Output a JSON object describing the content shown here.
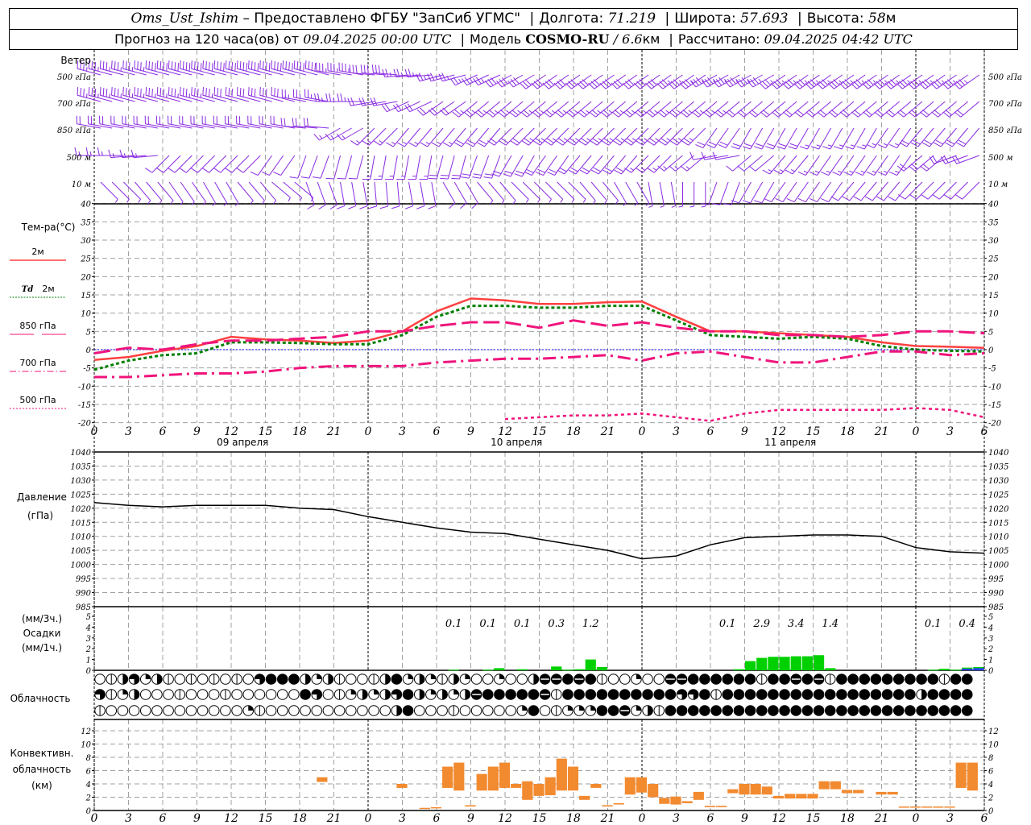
{
  "header": {
    "station": "Oms_Ust_Ishim",
    "provided": "– Предоставлено ФГБУ \"ЗапСиб УГМС\"",
    "lon_label": "Долгота:",
    "lon": "71.219",
    "lat_label": "Широта:",
    "lat": "57.693",
    "alt_label": "Высота:",
    "alt": "58",
    "alt_unit": "м",
    "forecast_label": "Прогноз на 120 часа(ов) от",
    "forecast_start": "09.04.2025 00:00 UTC",
    "model_label": "Модель",
    "model": "COSMO-RU",
    "model_res": "/ 6.6",
    "model_res_unit": "км",
    "computed_label": "Рассчитано:",
    "computed": "09.04.2025 04:42 UTC"
  },
  "labels": {
    "wind": "Ветер",
    "levels": [
      "500 гПа",
      "700 гПа",
      "850 гПа",
      "500 м",
      "10 м"
    ],
    "temp": "Тем-ра(°С)",
    "t2m": "2м",
    "td": "Td",
    "td2m": "2м",
    "t850": "850 гПа",
    "t700": "700 гПа",
    "t500": "500 гПа",
    "pressure": "Давление",
    "pressure_unit": "(гПа)",
    "precip_3h": "(мм/3ч.)",
    "precip": "Осадки",
    "precip_1h": "(мм/1ч.)",
    "cloud": "Облачность",
    "conv1": "Конвективн.",
    "conv2": "облачность",
    "conv3": "(км)"
  },
  "colors": {
    "wind": "#8a2be2",
    "t2m": "#ff4040",
    "td2m": "#008000",
    "levels": "#f0147c",
    "zero": "#0000ff",
    "pressure": "#000000",
    "rain": "#00d000",
    "snow": "#2040ff",
    "conv": "#f28a30",
    "grid": "#a0a0a0"
  },
  "chart_data": [
    {
      "type": "barbs",
      "name_label": "Ветер",
      "x_hours": [
        0,
        3,
        6,
        9,
        12,
        15,
        18,
        21,
        24,
        27,
        30,
        33,
        36,
        39,
        42,
        45,
        48,
        51,
        54,
        57,
        60,
        63,
        66,
        69,
        72,
        75,
        78
      ],
      "series": [
        {
          "name": "500 гПа",
          "dir": [
            285,
            285,
            285,
            285,
            285,
            285,
            285,
            280,
            275,
            265,
            255,
            245,
            240,
            235,
            235,
            235,
            235,
            235,
            240,
            240,
            235,
            235,
            235,
            235,
            235,
            235,
            235
          ],
          "speed": [
            35,
            35,
            40,
            40,
            40,
            40,
            40,
            35,
            30,
            25,
            25,
            25,
            30,
            30,
            30,
            30,
            30,
            35,
            35,
            35,
            35,
            35,
            35,
            35,
            35,
            35,
            35
          ]
        },
        {
          "name": "700 гПа",
          "dir": [
            285,
            285,
            285,
            285,
            285,
            285,
            280,
            270,
            260,
            245,
            235,
            230,
            230,
            230,
            230,
            230,
            230,
            230,
            230,
            230,
            230,
            230,
            230,
            230,
            230,
            230,
            230
          ],
          "speed": [
            35,
            35,
            35,
            35,
            30,
            30,
            25,
            25,
            20,
            20,
            20,
            25,
            25,
            25,
            25,
            25,
            25,
            25,
            25,
            20,
            20,
            20,
            20,
            20,
            20,
            20,
            20
          ]
        },
        {
          "name": "850 гПа",
          "dir": [
            280,
            280,
            280,
            280,
            280,
            280,
            275,
            240,
            225,
            220,
            220,
            220,
            225,
            225,
            225,
            225,
            225,
            225,
            215,
            210,
            210,
            210,
            210,
            215,
            220,
            220,
            220
          ],
          "speed": [
            20,
            20,
            20,
            20,
            20,
            20,
            20,
            15,
            15,
            15,
            15,
            20,
            20,
            25,
            25,
            25,
            25,
            25,
            20,
            20,
            20,
            15,
            15,
            15,
            20,
            20,
            20
          ]
        },
        {
          "name": "500 м",
          "dir": [
            270,
            265,
            225,
            225,
            225,
            215,
            200,
            195,
            190,
            190,
            195,
            200,
            210,
            215,
            220,
            220,
            225,
            230,
            260,
            230,
            220,
            215,
            215,
            215,
            230,
            250,
            240
          ],
          "speed": [
            15,
            15,
            10,
            10,
            10,
            10,
            10,
            10,
            15,
            15,
            20,
            20,
            20,
            20,
            20,
            20,
            15,
            15,
            10,
            10,
            15,
            15,
            15,
            15,
            20,
            20,
            15
          ]
        },
        {
          "name": "10 м",
          "dir": [
            135,
            140,
            145,
            150,
            140,
            130,
            160,
            170,
            175,
            170,
            150,
            140,
            135,
            135,
            140,
            150,
            170,
            180,
            200,
            210,
            215,
            215,
            220,
            220,
            225,
            225,
            225
          ],
          "speed": [
            5,
            5,
            5,
            5,
            5,
            5,
            10,
            10,
            10,
            10,
            10,
            5,
            5,
            5,
            5,
            5,
            5,
            5,
            10,
            10,
            10,
            10,
            10,
            10,
            10,
            10,
            10
          ]
        }
      ]
    },
    {
      "type": "line",
      "ylabel": "Тем-ра(°С)",
      "ylim": [
        -20,
        40
      ],
      "yticks": [
        40,
        35,
        30,
        25,
        20,
        15,
        10,
        5,
        0,
        -5,
        -10,
        -15,
        -20
      ],
      "grid": true,
      "x_hours": [
        0,
        3,
        6,
        9,
        12,
        15,
        18,
        21,
        24,
        27,
        30,
        33,
        36,
        39,
        42,
        45,
        48,
        51,
        54,
        57,
        60,
        63,
        66,
        69,
        72,
        75,
        78
      ],
      "x_tick_labels": [
        "0",
        "3",
        "6",
        "9",
        "12",
        "15",
        "18",
        "21",
        "0",
        "3",
        "6",
        "9",
        "12",
        "15",
        "18",
        "21",
        "0",
        "3",
        "6",
        "9",
        "12",
        "15",
        "18",
        "21",
        "0",
        "3",
        "6"
      ],
      "date_labels": [
        {
          "hour": 13,
          "text": "09 апреля"
        },
        {
          "hour": 37,
          "text": "10 апреля"
        },
        {
          "hour": 61,
          "text": "11 апреля"
        }
      ],
      "series": [
        {
          "name": "2м",
          "values": [
            -2.8,
            -2,
            -0.3,
            1,
            3.5,
            2.8,
            2.5,
            1.8,
            2.5,
            5,
            10.5,
            14,
            13.5,
            12.5,
            12.5,
            13,
            13.2,
            9,
            5,
            5,
            4.5,
            4,
            3.5,
            2,
            1,
            0.8,
            0.5
          ]
        },
        {
          "name": "Td 2м",
          "values": [
            -5.5,
            -3,
            -1.5,
            -1,
            2,
            2,
            1.8,
            1.5,
            1.5,
            4,
            9,
            12,
            12,
            11.5,
            11.5,
            12,
            12,
            8,
            4,
            3.5,
            3,
            3.5,
            3,
            1,
            0,
            -0.3,
            -0.5
          ]
        },
        {
          "name": "850 гПа",
          "values": [
            -1,
            0.5,
            0,
            1.5,
            2.5,
            2.5,
            3,
            3.5,
            5,
            5,
            6.5,
            7.5,
            7.5,
            6,
            8,
            6.5,
            7.5,
            6,
            5,
            5,
            4,
            4,
            3.5,
            4,
            5,
            5,
            4.5
          ]
        },
        {
          "name": "700 гПа",
          "values": [
            -7.5,
            -7.5,
            -7,
            -6.5,
            -6.5,
            -6,
            -5,
            -4.5,
            -4.5,
            -4.5,
            -3.5,
            -3,
            -2.5,
            -2.5,
            -2,
            -1.5,
            -3,
            -1,
            -0.5,
            -2,
            -3.5,
            -3.5,
            -2,
            -0.5,
            -0.5,
            -1.5,
            -1
          ]
        },
        {
          "name": "500 гПа",
          "values": [
            null,
            null,
            null,
            null,
            null,
            null,
            null,
            null,
            null,
            null,
            null,
            null,
            -19,
            -18.5,
            -18,
            -18,
            -17.5,
            -18.5,
            -19.5,
            -17.5,
            -16.5,
            -16.5,
            -16.5,
            -16.5,
            -16,
            -16.5,
            -18.5
          ]
        }
      ]
    },
    {
      "type": "line",
      "ylabel": "Давление (гПа)",
      "ylim": [
        985,
        1040
      ],
      "yticks": [
        1040,
        1035,
        1030,
        1025,
        1020,
        1015,
        1010,
        1005,
        1000,
        995,
        990,
        985
      ],
      "grid": true,
      "x_hours": [
        0,
        3,
        6,
        9,
        12,
        15,
        18,
        21,
        24,
        27,
        30,
        33,
        36,
        39,
        42,
        45,
        48,
        51,
        54,
        57,
        60,
        63,
        66,
        69,
        72,
        75,
        78
      ],
      "values": [
        1022,
        1021,
        1020.5,
        1021,
        1021,
        1021,
        1020,
        1019.5,
        1017,
        1015,
        1013,
        1011.5,
        1011,
        1009,
        1007,
        1005,
        1002,
        1003,
        1007,
        1009.5,
        1010,
        1010.5,
        1010.5,
        1010,
        1006,
        1004.5,
        1004
      ]
    },
    {
      "type": "bar",
      "ylabel": "Осадки",
      "ylim": [
        0,
        5
      ],
      "yticks": [
        0,
        1,
        2,
        3,
        4,
        5
      ],
      "hourly_precip_mm": {
        "31": 0.05,
        "34": 0.05,
        "35": 0.2,
        "37": 0.1,
        "40": 0.35,
        "41": 0.05,
        "42": 0.1,
        "43": 1.0,
        "44": 0.3,
        "56": 0.1,
        "57": 0.85,
        "58": 1.15,
        "59": 1.25,
        "60": 1.25,
        "61": 1.3,
        "62": 1.3,
        "63": 1.4,
        "64": 0.2,
        "73": 0.05,
        "74": 0.15,
        "75": 0.05,
        "76": 0.25,
        "77": 0.3
      },
      "hourly_snow_mm": {
        "76": 0.15,
        "77": 0.2
      },
      "totals_3h": [
        {
          "from": 30,
          "value": "0.1"
        },
        {
          "from": 33,
          "value": "0.1"
        },
        {
          "from": 36,
          "value": "0.1"
        },
        {
          "from": 39,
          "value": "0.3"
        },
        {
          "from": 42,
          "value": "1.2"
        },
        {
          "from": 54,
          "value": "0.1"
        },
        {
          "from": 57,
          "value": "2.9"
        },
        {
          "from": 60,
          "value": "3.4"
        },
        {
          "from": 63,
          "value": "1.4"
        },
        {
          "from": 72,
          "value": "0.1"
        },
        {
          "from": 75,
          "value": "0.4"
        }
      ]
    },
    {
      "type": "symbols",
      "ylabel": "Облачность",
      "scale": "oktas",
      "rows": [
        "01462410101010688842410014824214200200477878100200778888881887871888888888188",
        "61240001000100000086012424684242478888871888888888866818888888888888888848888",
        "10000000000002100000000000480001000002801222887241888888888888888888888888888"
      ]
    },
    {
      "type": "floating-bar",
      "ylabel": "Конвективн. облачность (км)",
      "ylim": [
        0,
        13
      ],
      "yticks": [
        0,
        2,
        4,
        6,
        8,
        10,
        12
      ],
      "grid": true,
      "x_tick_labels": [
        "0",
        "3",
        "6",
        "9",
        "12",
        "15",
        "18",
        "21",
        "0",
        "3",
        "6",
        "9",
        "12",
        "15",
        "18",
        "21",
        "0",
        "3",
        "6",
        "9",
        "12",
        "15",
        "18",
        "21",
        "0",
        "3",
        "6"
      ],
      "bars": [
        [
          20,
          4.3,
          5.0
        ],
        [
          27,
          3.4,
          4.0
        ],
        [
          29,
          0.3,
          0.4
        ],
        [
          30,
          0.4,
          0.5
        ],
        [
          31,
          3.4,
          6.6
        ],
        [
          32,
          3.0,
          7.2
        ],
        [
          33,
          0.6,
          0.8
        ],
        [
          34,
          3.0,
          5.5
        ],
        [
          35,
          3.0,
          6.6
        ],
        [
          36,
          3.4,
          7.2
        ],
        [
          37,
          3.4,
          4.0
        ],
        [
          38,
          1.6,
          4.4
        ],
        [
          39,
          2.2,
          4.0
        ],
        [
          40,
          2.3,
          5.0
        ],
        [
          41,
          3.0,
          7.8
        ],
        [
          42,
          3.0,
          6.6
        ],
        [
          43,
          1.6,
          2.2
        ],
        [
          44,
          3.4,
          4.0
        ],
        [
          45,
          0.6,
          0.8
        ],
        [
          46,
          0.9,
          1.1
        ],
        [
          47,
          2.4,
          5.0
        ],
        [
          48,
          2.7,
          5.0
        ],
        [
          49,
          2.0,
          4.0
        ],
        [
          50,
          1.0,
          1.9
        ],
        [
          51,
          0.9,
          2.1
        ],
        [
          52,
          1.1,
          1.4
        ],
        [
          53,
          1.6,
          2.8
        ],
        [
          54,
          0.5,
          0.7
        ],
        [
          55,
          0.5,
          0.7
        ],
        [
          56,
          2.6,
          3.2
        ],
        [
          57,
          2.4,
          4.0
        ],
        [
          58,
          2.4,
          4.0
        ],
        [
          59,
          2.4,
          3.6
        ],
        [
          60,
          1.8,
          2.2
        ],
        [
          61,
          1.8,
          2.5
        ],
        [
          62,
          1.8,
          2.5
        ],
        [
          63,
          1.8,
          2.5
        ],
        [
          64,
          3.2,
          4.4
        ],
        [
          65,
          3.2,
          4.4
        ],
        [
          66,
          2.6,
          3.1
        ],
        [
          67,
          2.6,
          3.1
        ],
        [
          69,
          2.4,
          2.8
        ],
        [
          70,
          2.4,
          2.8
        ],
        [
          71,
          0.5,
          0.6
        ],
        [
          72,
          0.5,
          0.6
        ],
        [
          73,
          0.5,
          0.6
        ],
        [
          74,
          0.5,
          0.6
        ],
        [
          75,
          0.5,
          0.6
        ],
        [
          76,
          3.4,
          7.2
        ],
        [
          77,
          3.0,
          7.2
        ]
      ]
    }
  ]
}
